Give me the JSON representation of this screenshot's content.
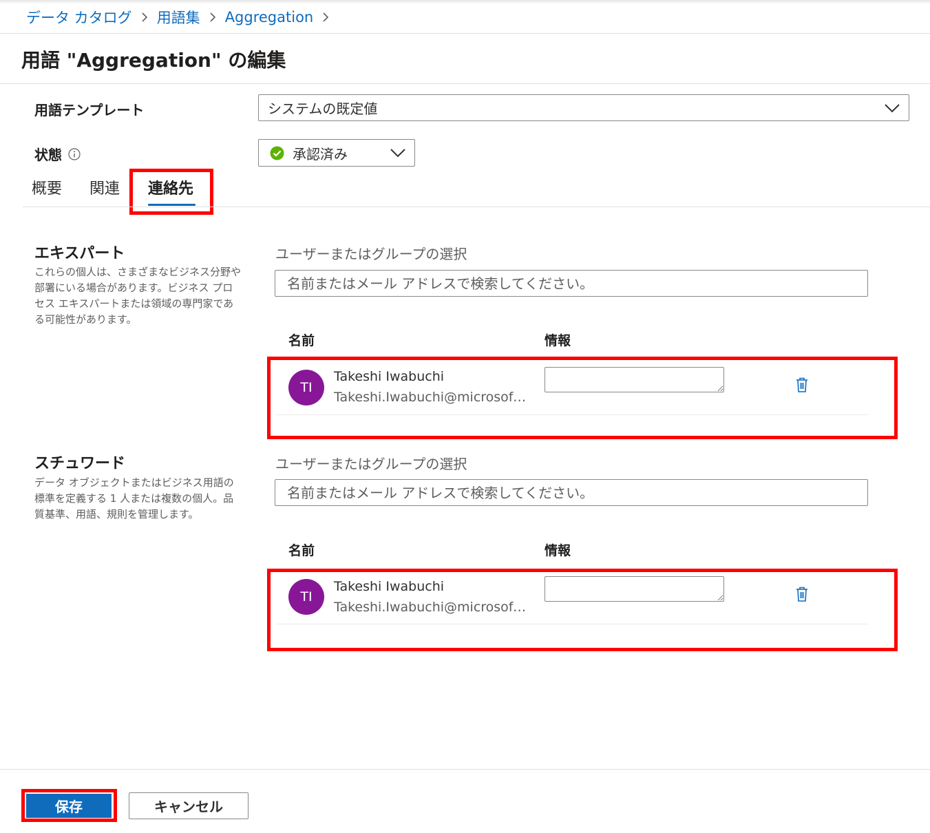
{
  "breadcrumb": {
    "items": [
      "データ カタログ",
      "用語集",
      "Aggregation"
    ]
  },
  "page_title": "用語 \"Aggregation\" の編集",
  "form": {
    "template_label": "用語テンプレート",
    "template_value": "システムの既定値",
    "status_label": "状態",
    "status_value": "承認済み"
  },
  "tabs": [
    {
      "label": "概要",
      "active": false
    },
    {
      "label": "関連",
      "active": false
    },
    {
      "label": "連絡先",
      "active": true
    }
  ],
  "experts": {
    "title": "エキスパート",
    "description": "これらの個人は、さまざまなビジネス分野や部署にいる場合があります。ビジネス プロセス エキスパートまたは領域の専門家である可能性があります。",
    "select_label": "ユーザーまたはグループの選択",
    "search_placeholder": "名前またはメール アドレスで検索してください。",
    "col_name": "名前",
    "col_info": "情報",
    "rows": [
      {
        "initials": "TI",
        "name": "Takeshi Iwabuchi",
        "email": "Takeshi.Iwabuchi@microsoft.com",
        "info": ""
      }
    ]
  },
  "stewards": {
    "title": "スチュワード",
    "description": "データ オブジェクトまたはビジネス用語の標準を定義する 1 人または複数の個人。品質基準、用語、規則を管理します。",
    "select_label": "ユーザーまたはグループの選択",
    "search_placeholder": "名前またはメール アドレスで検索してください。",
    "col_name": "名前",
    "col_info": "情報",
    "rows": [
      {
        "initials": "TI",
        "name": "Takeshi Iwabuchi",
        "email": "Takeshi.Iwabuchi@microsoft.com",
        "info": ""
      }
    ]
  },
  "buttons": {
    "save": "保存",
    "cancel": "キャンセル"
  },
  "colors": {
    "accent": "#0f6cbd",
    "avatar": "#881798",
    "status_ok": "#5db300",
    "highlight": "#ff0000"
  }
}
